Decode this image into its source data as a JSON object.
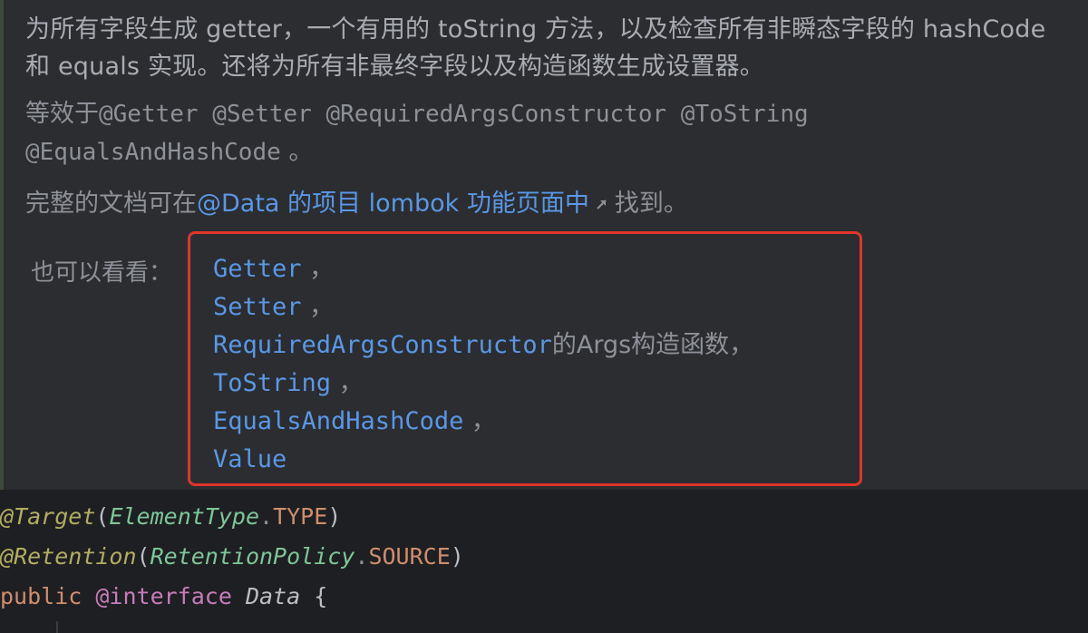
{
  "doc": {
    "description": "为所有字段生成 getter，一个有用的 toString 方法，以及检查所有非瞬态字段的 hashCode 和 equals 实现。还将为所有非最终字段以及构造函数生成设置器。",
    "equivalent_prefix": "等效于",
    "equivalent_code": "@Getter @Setter @RequiredArgsConstructor @ToString @EqualsAndHashCode",
    "equivalent_suffix": " 。",
    "fulldoc_prefix": "完整的文档可在",
    "fulldoc_link": "@Data 的项目 lombok 功能页面中",
    "fulldoc_suffix": "找到。",
    "see_also_label": "也可以看看：",
    "see_also": [
      {
        "link": "Getter",
        "suffix": " ，"
      },
      {
        "link": "Setter",
        "suffix": " ，"
      },
      {
        "link": "RequiredArgsConstructor",
        "suffix": "的Args构造函数，"
      },
      {
        "link": "ToString",
        "suffix": " ，"
      },
      {
        "link": "EqualsAndHashCode",
        "suffix": " ，"
      },
      {
        "link": "Value",
        "suffix": ""
      }
    ]
  },
  "code": {
    "line1": {
      "at": "@",
      "ann": "Target",
      "open": "(",
      "type": "ElementType",
      "dot": ".",
      "const": "TYPE",
      "close": ")"
    },
    "line2": {
      "at": "@",
      "ann": "Retention",
      "open": "(",
      "type": "RetentionPolicy",
      "dot": ".",
      "const": "SOURCE",
      "close": ")"
    },
    "line3": {
      "kw": "public",
      "at_iface": "@interface",
      "name": "Data",
      "brace": "{"
    }
  },
  "colors": {
    "highlight_border": "#e0352b",
    "link": "#5a97e6",
    "doc_background": "#2b2d30",
    "code_background": "#1e1f22"
  },
  "icons": {
    "external_link": "external-link-arrow-icon"
  }
}
